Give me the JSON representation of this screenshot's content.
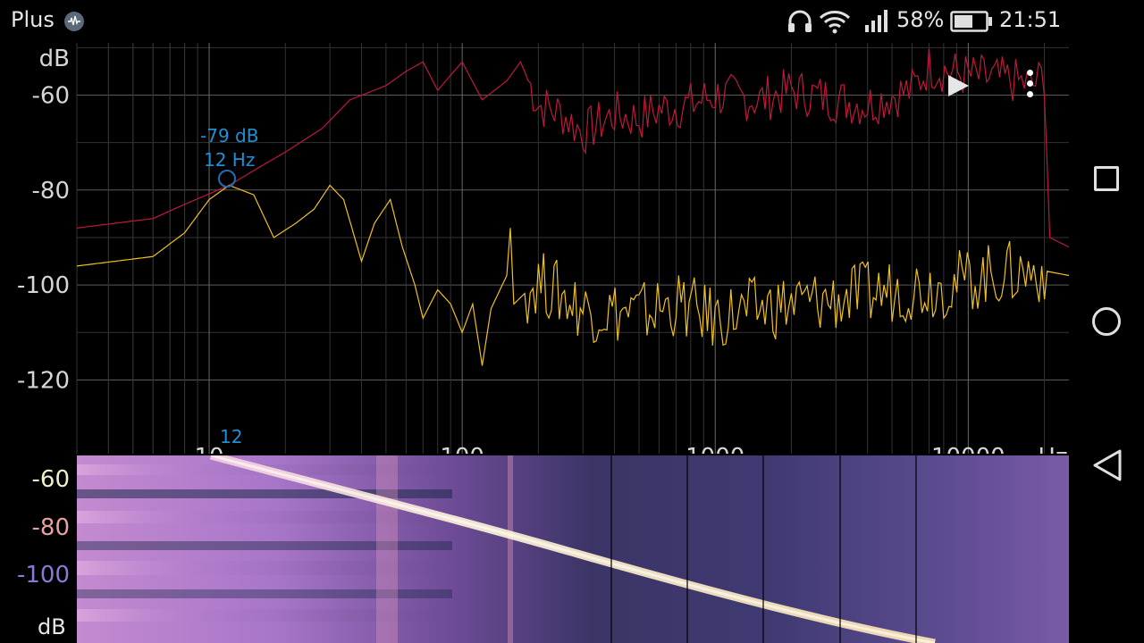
{
  "status_bar": {
    "app_name": "Plus",
    "battery_percent": "58%",
    "time": "21:51",
    "icons": [
      "app-badge-icon",
      "headphones-icon",
      "wifi-icon",
      "signal-icon",
      "battery-icon"
    ]
  },
  "chart_data": {
    "type": "line",
    "x_scale": "log",
    "xlim": [
      3,
      25000
    ],
    "ylim": [
      -128,
      -49
    ],
    "ylabel": "dB",
    "xlabel": "Hz",
    "y_ticks": [
      "-60",
      "-80",
      "-100",
      "-120"
    ],
    "x_ticks": [
      "10",
      "100",
      "1000",
      "10000"
    ],
    "grid": true,
    "series": [
      {
        "color": "#c0183a",
        "points": [
          [
            3,
            -88
          ],
          [
            6,
            -86
          ],
          [
            8,
            -83
          ],
          [
            12,
            -79
          ],
          [
            16,
            -75
          ],
          [
            20,
            -72
          ],
          [
            28,
            -67
          ],
          [
            36,
            -61
          ],
          [
            50,
            -58
          ],
          [
            60,
            -55
          ],
          [
            70,
            -53
          ],
          [
            80,
            -59
          ],
          [
            100,
            -53
          ],
          [
            120,
            -61
          ],
          [
            150,
            -57
          ],
          [
            170,
            -53
          ],
          [
            200,
            -62
          ],
          [
            250,
            -64
          ],
          [
            300,
            -68
          ],
          [
            400,
            -64
          ],
          [
            500,
            -65
          ],
          [
            600,
            -63
          ],
          [
            800,
            -62
          ],
          [
            1000,
            -60
          ],
          [
            1500,
            -61
          ],
          [
            2000,
            -59
          ],
          [
            3000,
            -61
          ],
          [
            4000,
            -62
          ],
          [
            5000,
            -60
          ],
          [
            6000,
            -59
          ],
          [
            7000,
            -54
          ],
          [
            10000,
            -56
          ],
          [
            15000,
            -57
          ],
          [
            18000,
            -58
          ],
          [
            20000,
            -56
          ],
          [
            21000,
            -90
          ],
          [
            25000,
            -92
          ]
        ]
      },
      {
        "color": "#f0c020",
        "points": [
          [
            3,
            -96
          ],
          [
            6,
            -94
          ],
          [
            8,
            -89
          ],
          [
            10,
            -82
          ],
          [
            12,
            -79
          ],
          [
            15,
            -81
          ],
          [
            18,
            -90
          ],
          [
            22,
            -87
          ],
          [
            26,
            -84
          ],
          [
            30,
            -79
          ],
          [
            34,
            -82
          ],
          [
            40,
            -95
          ],
          [
            45,
            -87
          ],
          [
            52,
            -82
          ],
          [
            58,
            -92
          ],
          [
            65,
            -100
          ],
          [
            70,
            -107
          ],
          [
            80,
            -101
          ],
          [
            90,
            -104
          ],
          [
            100,
            -110
          ],
          [
            110,
            -104
          ],
          [
            120,
            -117
          ],
          [
            130,
            -105
          ],
          [
            150,
            -98
          ],
          [
            155,
            -88
          ],
          [
            160,
            -104
          ],
          [
            200,
            -99
          ],
          [
            300,
            -105
          ],
          [
            500,
            -106
          ],
          [
            700,
            -104
          ],
          [
            1000,
            -107
          ],
          [
            1500,
            -105
          ],
          [
            2000,
            -104
          ],
          [
            3000,
            -103
          ],
          [
            5000,
            -101
          ],
          [
            8000,
            -100
          ],
          [
            12000,
            -98
          ],
          [
            20000,
            -97
          ],
          [
            25000,
            -98
          ]
        ]
      }
    ]
  },
  "cursor": {
    "db_label": "-79 dB",
    "hz_label": "12 Hz",
    "axis_marker": "12"
  },
  "controls": {
    "play": "play-icon",
    "menu": "overflow-menu-icon"
  },
  "spectrogram": {
    "y_labels": [
      {
        "text": "-60",
        "color": "#f2efc8"
      },
      {
        "text": "-80",
        "color": "#e8a0a0"
      },
      {
        "text": "-100",
        "color": "#8a7ad8"
      }
    ],
    "db_label": "dB"
  },
  "nav_bar": {
    "icons": [
      "recents-icon",
      "home-icon",
      "back-icon"
    ]
  }
}
